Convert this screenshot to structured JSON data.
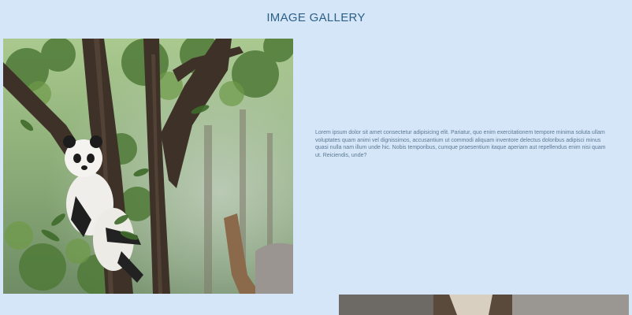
{
  "gallery": {
    "title": "IMAGE GALLERY",
    "items": [
      {
        "image": "panda-in-tree-photo",
        "description": "Lorem ipsum dolor sit amet consectetur adipisicing elit. Pariatur, quo enim exercitationem tempore minima soluta ullam voluptates quam animi vel dignissimos, accusantium ut commodi aliquam inventore delectus doloribus adipisci minus quasi nulla nam illum unde hic. Nobis temporibus, cumque praesentium itaque aperiam aut repellendus enim nisi quam ut. Reiciendis, unde?"
      },
      {
        "image": "second-gallery-photo"
      }
    ]
  }
}
